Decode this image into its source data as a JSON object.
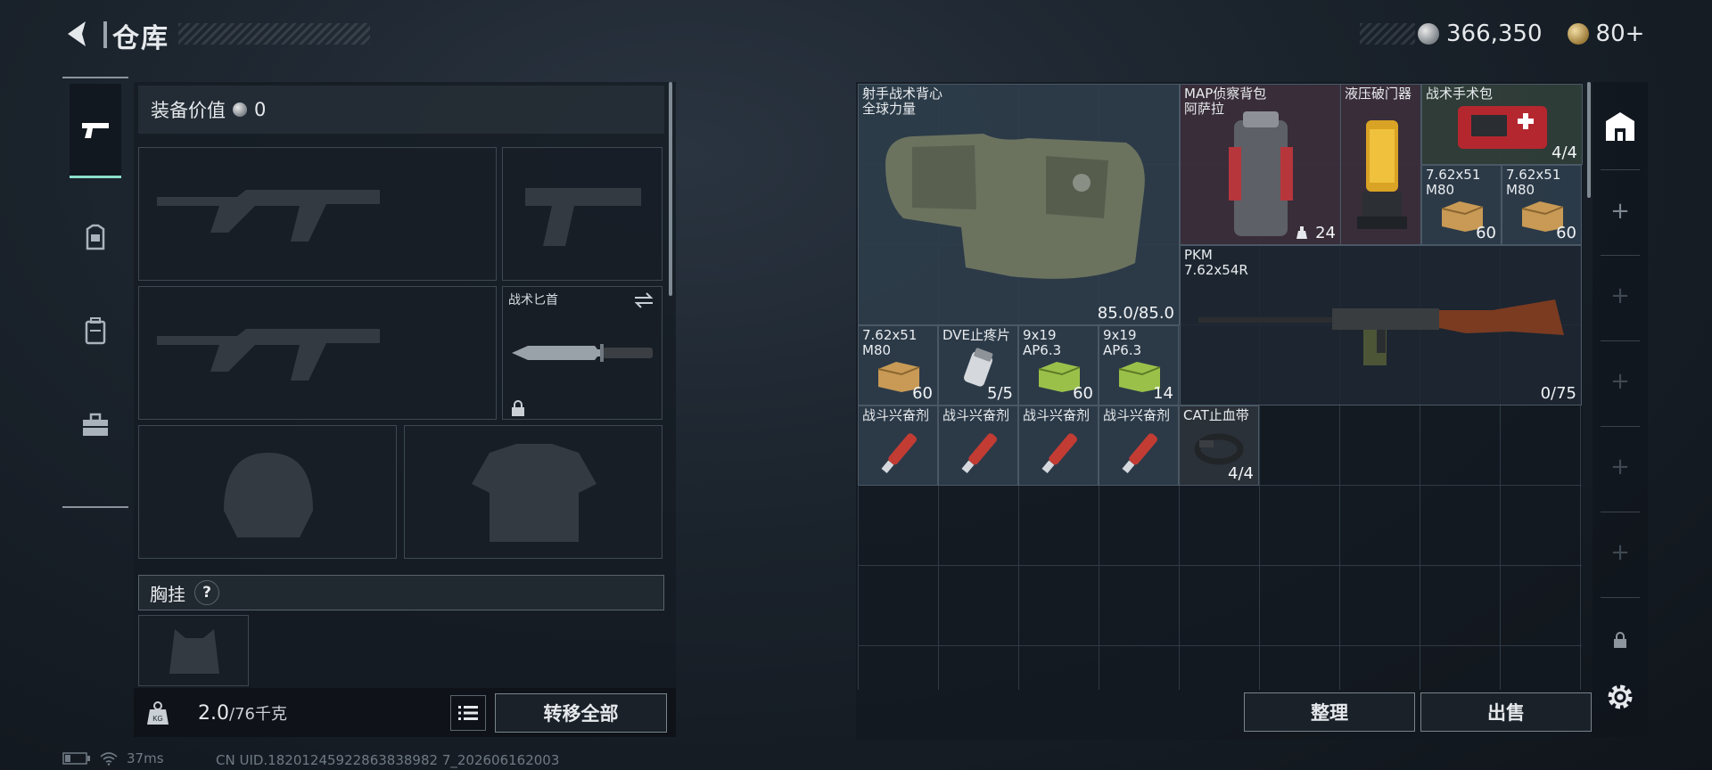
{
  "header": {
    "title": "仓库",
    "currency_silver": "366,350",
    "currency_gold": "80+"
  },
  "nav": {
    "items": [
      "weapons-icon",
      "backpack-icon",
      "vest-icon",
      "toolbox-icon"
    ],
    "active_index": 0
  },
  "loadout": {
    "equipment_value_label": "装备价值",
    "equipment_value": "0",
    "melee_slot_label": "战术匕首",
    "chest_rig_label": "胸挂",
    "help_mark": "?",
    "weight_current": "2.0",
    "weight_max": "/76千克",
    "transfer_all_label": "转移全部"
  },
  "storage": {
    "items": [
      {
        "name": "射手战术背心\n全球力量",
        "count": "85.0/85.0"
      },
      {
        "name": "MAP侦察背包\n阿萨拉",
        "count": "24"
      },
      {
        "name": "液压破门器",
        "count": ""
      },
      {
        "name": "战术手术包",
        "count": "4/4"
      },
      {
        "name": "7.62x51\nM80",
        "count": "60"
      },
      {
        "name": "7.62x51\nM80",
        "count": "60"
      },
      {
        "name": "PKM\n7.62x54R",
        "count": "0/75"
      },
      {
        "name": "7.62x51\nM80",
        "count": "60"
      },
      {
        "name": "DVE止疼片",
        "count": "5/5"
      },
      {
        "name": "9x19\nAP6.3",
        "count": "60"
      },
      {
        "name": "9x19\nAP6.3",
        "count": "14"
      },
      {
        "name": "战斗兴奋剂",
        "count": ""
      },
      {
        "name": "战斗兴奋剂",
        "count": ""
      },
      {
        "name": "战斗兴奋剂",
        "count": ""
      },
      {
        "name": "战斗兴奋剂",
        "count": ""
      },
      {
        "name": "CAT止血带",
        "count": "4/4"
      }
    ],
    "sort_label": "整理",
    "sell_label": "出售"
  },
  "status": {
    "ping": "37ms",
    "uid": "CN UID.18201245922863838982 7_202606162003"
  },
  "colors": {
    "accent": "#8be0c9",
    "panel": "#1a2129",
    "item_bg": "#2f3e4c"
  }
}
